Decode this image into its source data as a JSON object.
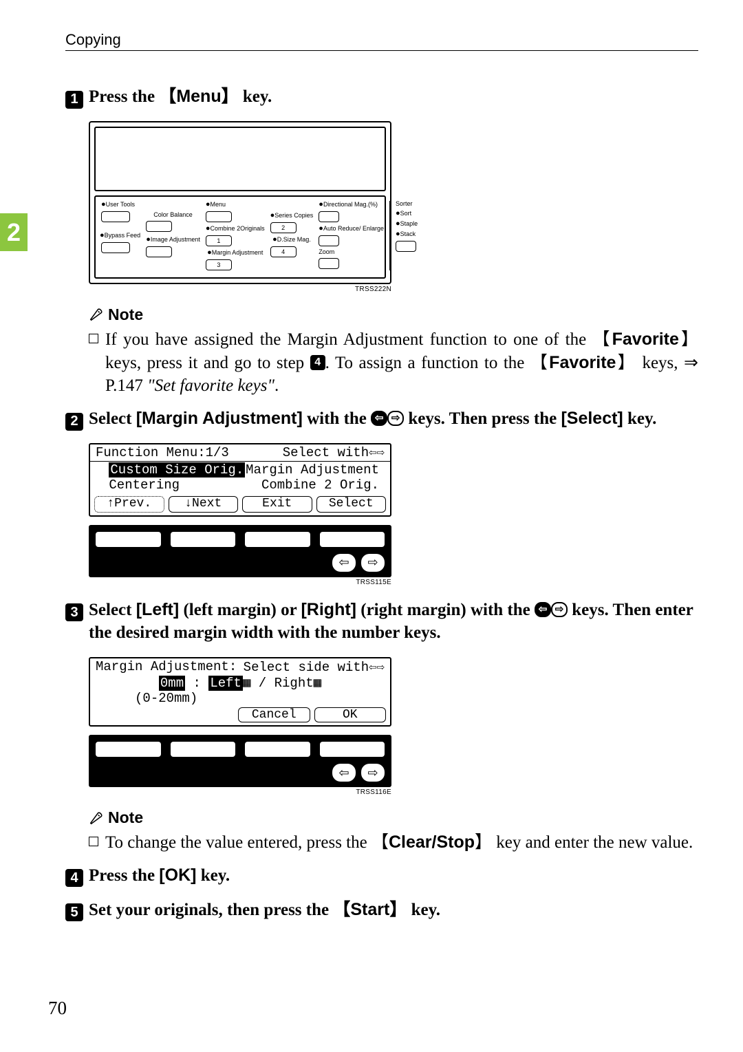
{
  "header": {
    "running_head": "Copying"
  },
  "tab": {
    "chapter": "2"
  },
  "steps": {
    "s1": {
      "num": "1",
      "text_a": "Press the ",
      "key": "Menu",
      "text_b": " key."
    },
    "s2": {
      "num": "2",
      "text_a": "Select ",
      "label": "[Margin Adjustment]",
      "text_b": " with the ",
      "text_c": " keys. Then press the ",
      "label2": "[Select]",
      "text_d": " key."
    },
    "s3": {
      "num": "3",
      "text_a": "Select ",
      "label_l": "[Left]",
      "paren_l": " (left margin) or ",
      "label_r": "[Right]",
      "paren_r": " (right margin) with the ",
      "tail_a": " keys. Then enter the desired margin width with the number keys."
    },
    "s4": {
      "num": "4",
      "text_a": "Press the ",
      "label": "[OK]",
      "text_b": " key."
    },
    "s5": {
      "num": "5",
      "text_a": "Set your originals, then press the ",
      "key": "Start",
      "text_b": " key."
    }
  },
  "panel": {
    "user_tools": "User Tools",
    "menu": "Menu",
    "directional_mag": "Directional Mag.(%)",
    "sorter": "Sorter",
    "sort": "Sort",
    "staple": "Staple",
    "stack": "Stack",
    "color_balance": "Color Balance",
    "combine": "Combine 2Originals",
    "series": "Series Copies",
    "auto_reduce": "Auto Reduce/ Enlarge",
    "bypass": "Bypass Feed",
    "image_adj": "Image Adjustment",
    "margin_adj": "Margin Adjustment",
    "dsize": "D.Size Mag.",
    "zoom": "Zoom",
    "n1": "1",
    "n2": "2",
    "n3": "3",
    "n4": "4",
    "fig_code": "TRSS222N"
  },
  "note1": {
    "head": "Note",
    "body_a": "If you have assigned the Margin Adjustment function to one of the ",
    "k_fav1": "Favorite",
    "body_b": " keys, press it and go to step ",
    "step_ref": "4",
    "body_c": ". To assign a function to the ",
    "k_fav2": "Favorite",
    "body_d": " keys, ⇒ P.147 ",
    "ref_title": "\"Set favorite keys\"",
    "body_e": "."
  },
  "lcd1": {
    "title_l": "Function Menu:1/3",
    "title_r": "Select with",
    "row2_l": "Custom Size Orig.",
    "row2_r": "Margin Adjustment",
    "row3_l": "Centering",
    "row3_r": "Combine 2 Orig.",
    "b1": "↑Prev.",
    "b2": "↓Next",
    "b3": "Exit",
    "b4": "Select",
    "fig_code": "TRSS115E"
  },
  "lcd2": {
    "title_l": "Margin Adjustment:",
    "title_r": "Select side with",
    "val": "0mm",
    "sep": " : ",
    "left": "Left",
    "slash": " / ",
    "right": "Right",
    "range": "(0-20mm)",
    "b_cancel": "Cancel",
    "b_ok": "OK",
    "fig_code": "TRSS116E"
  },
  "note2": {
    "head": "Note",
    "body_a": "To change the value entered, press the ",
    "k_clear": "Clear/Stop",
    "body_b": " key and enter the new value."
  },
  "page_number": "70"
}
